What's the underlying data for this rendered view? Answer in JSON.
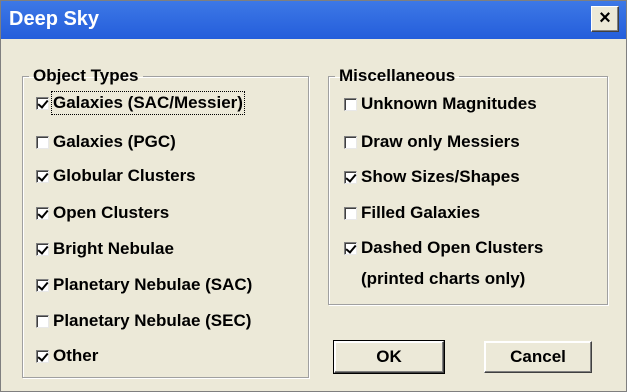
{
  "window": {
    "title": "Deep Sky",
    "close_glyph": "×"
  },
  "object_types": {
    "legend": "Object Types",
    "items": [
      {
        "label": "Galaxies (SAC/Messier)",
        "checked": true
      },
      {
        "label": "Galaxies (PGC)",
        "checked": false
      },
      {
        "label": "Globular Clusters",
        "checked": true
      },
      {
        "label": "Open Clusters",
        "checked": true
      },
      {
        "label": "Bright Nebulae",
        "checked": true
      },
      {
        "label": "Planetary Nebulae (SAC)",
        "checked": true
      },
      {
        "label": "Planetary Nebulae (SEC)",
        "checked": false
      },
      {
        "label": "Other",
        "checked": true
      }
    ]
  },
  "miscellaneous": {
    "legend": "Miscellaneous",
    "items": [
      {
        "label": "Unknown Magnitudes",
        "checked": false
      },
      {
        "label": "Draw only Messiers",
        "checked": false
      },
      {
        "label": "Show Sizes/Shapes",
        "checked": true
      },
      {
        "label": "Filled Galaxies",
        "checked": false
      },
      {
        "label": "Dashed Open Clusters",
        "checked": true
      }
    ],
    "note": "(printed charts only)"
  },
  "buttons": {
    "ok": "OK",
    "cancel": "Cancel"
  }
}
